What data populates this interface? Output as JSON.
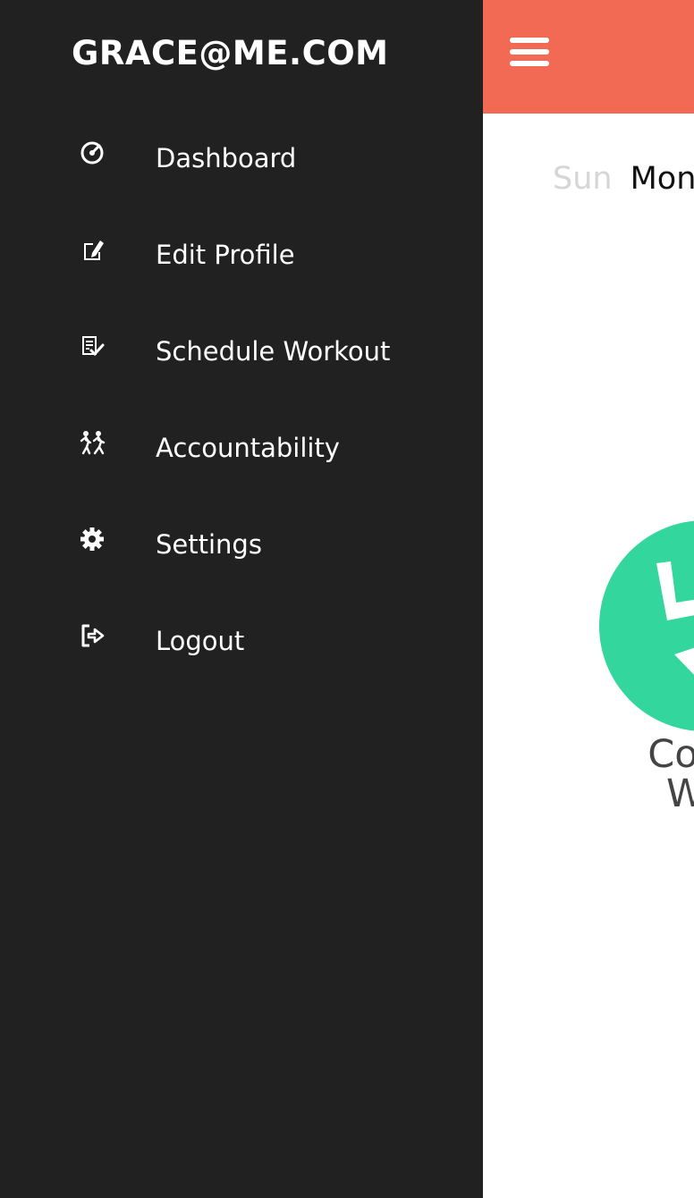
{
  "drawer": {
    "email": "GRACE@ME.COM",
    "items": [
      {
        "label": "Dashboard",
        "icon": "dashboard-gauge-icon"
      },
      {
        "label": "Edit Profile",
        "icon": "edit-profile-icon"
      },
      {
        "label": "Schedule Workout",
        "icon": "schedule-checklist-icon"
      },
      {
        "label": "Accountability",
        "icon": "running-people-icon"
      },
      {
        "label": "Settings",
        "icon": "gear-icon"
      },
      {
        "label": "Logout",
        "icon": "logout-icon"
      }
    ],
    "background_color": "#212121"
  },
  "main": {
    "topbar_color": "#f26a54",
    "menu_icon": "hamburger-menu-icon",
    "days": [
      "Sun",
      "Mon"
    ],
    "active_day": "Mon",
    "workout_button": {
      "icon": "workout-person-icon",
      "color": "#33d69c",
      "label_line1": "Comp",
      "label_line2": "Wor"
    }
  }
}
